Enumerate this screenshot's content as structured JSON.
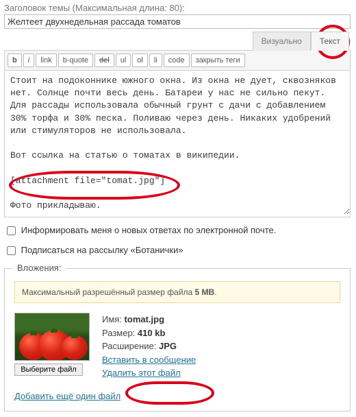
{
  "title": {
    "label": "Заголовок темы (Максимальная длина: 80):",
    "value": "Желтеет двухнедельная рассада томатов"
  },
  "tabs": {
    "visual": "Визуально",
    "text": "Текст"
  },
  "toolbar": {
    "b": "b",
    "i": "i",
    "link": "link",
    "bquote": "b-quote",
    "del": "del",
    "ul": "ul",
    "ol": "ol",
    "li": "li",
    "code": "code",
    "close": "закрыть теги"
  },
  "editor": {
    "content": "Стоит на подоконнике южного окна. Из окна не дует, сквозняков нет. Солнце почти весь день. Батареи у нас не сильно пекут. Для рассады использовала обычный грунт с дачи с добавлением 30% торфа и 30% песка. Поливаю через день. Никаких удобрений или стимуляторов не использовала.\n\nВот ссылка на статью о томатах в википедии.\n\n[attachment file=\"tomat.jpg\"]\n\nФото прикладываю."
  },
  "options": {
    "notify": "Информировать меня о новых ответах по электронной почте.",
    "subscribe": "Подписаться на рассылку «Ботанички»"
  },
  "attachments": {
    "legend": "Вложения:",
    "size_note_pre": "Максимальный разрешённый размер файла ",
    "size_note_val": "5 MB",
    "file": {
      "choose": "Выберите файл",
      "name_k": "Имя: ",
      "name_v": "tomat.jpg",
      "size_k": "Размер: ",
      "size_v": "410 kb",
      "ext_k": "Расширение: ",
      "ext_v": "JPG",
      "insert": "Вставить в сообщение",
      "delete": "Удалить этот файл"
    },
    "add_more": "Добавить ещё один файл"
  }
}
